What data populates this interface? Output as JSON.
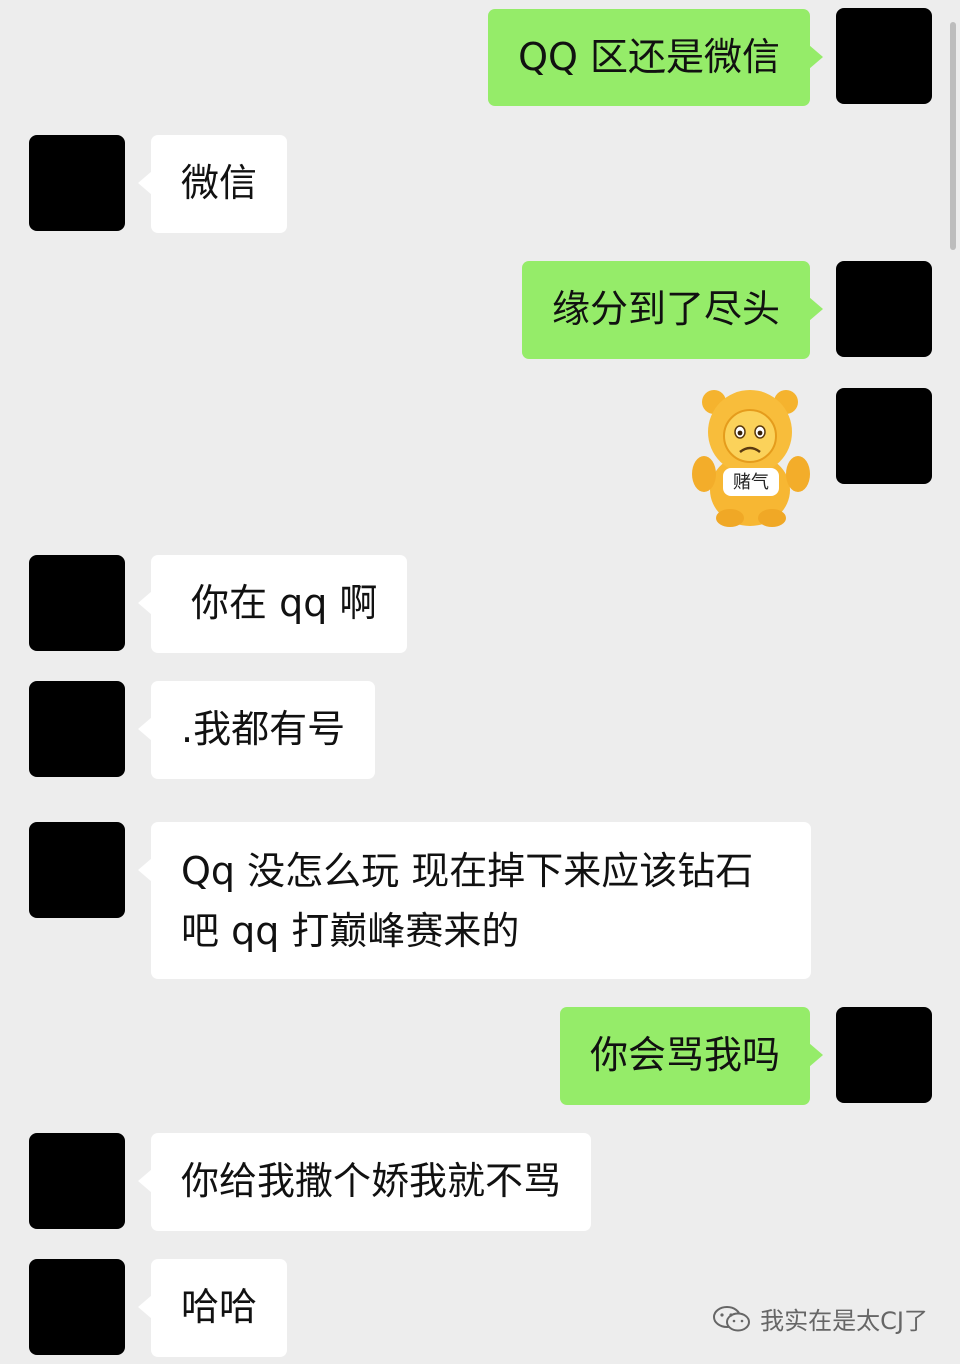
{
  "messages": [
    {
      "side": "out",
      "text": "QQ 区还是微信"
    },
    {
      "side": "in",
      "text": "微信"
    },
    {
      "side": "out",
      "text": "缘分到了尽头"
    },
    {
      "side": "out",
      "type": "sticker",
      "sticker_label": "赌气"
    },
    {
      "side": "in",
      "text": "你在 qq 啊"
    },
    {
      "side": "in",
      "text": ".我都有号"
    },
    {
      "side": "in",
      "text": "Qq 没怎么玩 现在掉下来应该钻石 吧  qq 打巅峰赛来的"
    },
    {
      "side": "out",
      "text": "你会骂我吗"
    },
    {
      "side": "in",
      "text": "你给我撒个娇我就不骂"
    },
    {
      "side": "in",
      "text": "哈哈"
    }
  ],
  "watermark": {
    "text": "我实在是太CJ了",
    "icon": "wechat-icon"
  },
  "colors": {
    "background": "#ededed",
    "outgoing_bubble": "#95ec69",
    "incoming_bubble": "#ffffff",
    "avatar": "#000000"
  }
}
